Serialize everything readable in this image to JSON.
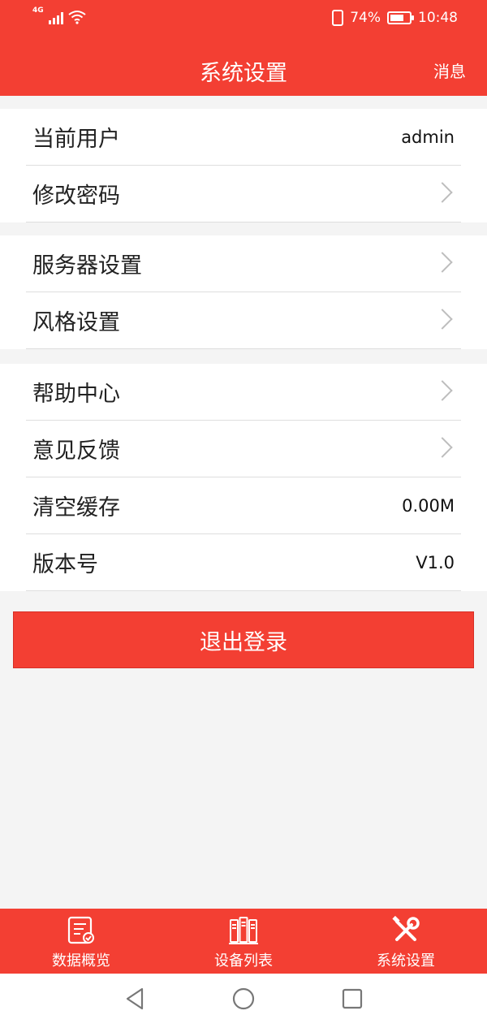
{
  "status_bar": {
    "network": "4G",
    "battery": "74%",
    "time": "10:48",
    "battery_level": 0.74
  },
  "header": {
    "title": "系统设置",
    "message_label": "消息"
  },
  "groups": [
    {
      "items": [
        {
          "label": "当前用户",
          "value": "admin"
        },
        {
          "label": "修改密码",
          "icon": "chevron-right-icon"
        }
      ]
    },
    {
      "items": [
        {
          "label": "服务器设置",
          "icon": "chevron-right-icon"
        },
        {
          "label": "风格设置",
          "icon": "chevron-right-icon"
        }
      ]
    },
    {
      "items": [
        {
          "label": "帮助中心",
          "icon": "chevron-right-icon"
        },
        {
          "label": "意见反馈",
          "icon": "chevron-right-icon"
        },
        {
          "label": "清空缓存",
          "value": "0.00M"
        },
        {
          "label": "版本号",
          "value": "V1.0"
        }
      ]
    }
  ],
  "logout_label": "退出登录",
  "tabs": [
    {
      "label": "数据概览",
      "icon": "document-check-icon"
    },
    {
      "label": "设备列表",
      "icon": "server-rack-icon"
    },
    {
      "label": "系统设置",
      "icon": "tools-icon"
    }
  ],
  "colors": {
    "primary": "#f33f33",
    "background": "#f4f4f4",
    "divider": "#dedede",
    "chevron": "#bdbdbd"
  }
}
